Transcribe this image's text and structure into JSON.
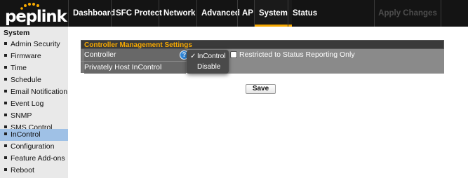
{
  "brand": {
    "logo_text": "peplink",
    "accent": "#f6a800",
    "dot_color": "#f6a800"
  },
  "nav": {
    "items": [
      {
        "label": "Dashboard"
      },
      {
        "label": "SFC Protect"
      },
      {
        "label": "Network"
      },
      {
        "label": "Advanced"
      },
      {
        "label": "AP"
      },
      {
        "label": "System",
        "active": true
      },
      {
        "label": "Status"
      }
    ],
    "apply_label": "Apply Changes"
  },
  "sidebar": {
    "heading": "System",
    "items": [
      {
        "label": "Admin Security"
      },
      {
        "label": "Firmware"
      },
      {
        "label": "Time"
      },
      {
        "label": "Schedule"
      },
      {
        "label": "Email Notification"
      },
      {
        "label": "Event Log"
      },
      {
        "label": "SNMP"
      },
      {
        "label": "SMS Control"
      },
      {
        "label": "InControl",
        "active": true
      },
      {
        "label": "Configuration"
      },
      {
        "label": "Feature Add-ons"
      },
      {
        "label": "Reboot"
      }
    ]
  },
  "panel": {
    "title": "Controller Management Settings",
    "rows": {
      "controller": {
        "label": "Controller",
        "help_icon": "?",
        "checkbox_label": "Restricted to Status Reporting Only",
        "checked": false
      },
      "private_host": {
        "label": "Privately Host InControl"
      }
    }
  },
  "controller_dropdown": {
    "options": [
      {
        "label": "InControl",
        "selected": true,
        "check": "✓"
      },
      {
        "label": "Disable",
        "selected": false
      }
    ]
  },
  "save_label": "Save"
}
